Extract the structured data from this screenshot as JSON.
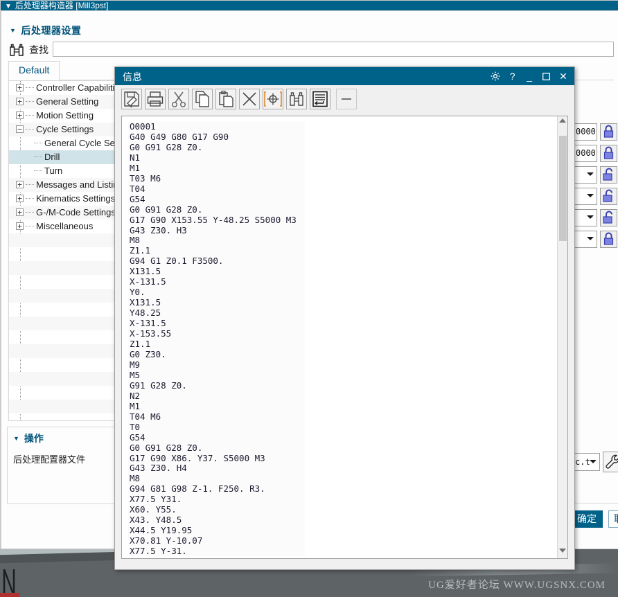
{
  "app": {
    "titlebar": "后处理器构造器  [Mill3pst]",
    "section_title": "后处理器设置",
    "find": {
      "label": "查找",
      "value": "",
      "placeholder": "",
      "icon": "binoculars-icon"
    },
    "tabs": [
      {
        "label": "Default",
        "active": true
      }
    ]
  },
  "tree": {
    "items": [
      {
        "label": "Controller Capabilities",
        "level": 0,
        "state": "collapsed",
        "selected": false
      },
      {
        "label": "General Setting",
        "level": 0,
        "state": "collapsed",
        "selected": false
      },
      {
        "label": "Motion Setting",
        "level": 0,
        "state": "collapsed",
        "selected": false
      },
      {
        "label": "Cycle Settings",
        "level": 0,
        "state": "expanded",
        "selected": false
      },
      {
        "label": "General Cycle Setting",
        "level": 1,
        "state": "leaf",
        "selected": false
      },
      {
        "label": "Drill",
        "level": 1,
        "state": "leaf",
        "selected": true
      },
      {
        "label": "Turn",
        "level": 1,
        "state": "leaf-last",
        "selected": false
      },
      {
        "label": "Messages and Listing",
        "level": 0,
        "state": "collapsed",
        "selected": false
      },
      {
        "label": "Kinematics Settings",
        "level": 0,
        "state": "collapsed",
        "selected": false
      },
      {
        "label": "G-/M-Code Settings",
        "level": 0,
        "state": "collapsed",
        "selected": false
      },
      {
        "label": "Miscellaneous",
        "level": 0,
        "state": "collapsed",
        "selected": false
      }
    ]
  },
  "operations": {
    "title": "操作",
    "items": [
      "后处理配置器文件"
    ]
  },
  "right_panel": {
    "rows": [
      {
        "type": "field",
        "value": "0000",
        "lock": "locked"
      },
      {
        "type": "field",
        "value": "0000",
        "lock": "locked"
      },
      {
        "type": "combo",
        "value": "",
        "lock": "unlocked"
      },
      {
        "type": "combo",
        "value": "",
        "lock": "unlocked"
      },
      {
        "type": "combo",
        "value": "",
        "lock": "unlocked"
      },
      {
        "type": "combo",
        "value": "",
        "lock": "locked"
      }
    ],
    "bottom_combo": "c.t",
    "wrench_icon": "wrench-icon"
  },
  "footer": {
    "ok_label": "确定",
    "second_label": "取"
  },
  "dialog": {
    "title": "信息",
    "window_buttons": [
      {
        "name": "settings-icon",
        "glyph": "⚙"
      },
      {
        "name": "help-icon",
        "glyph": "?"
      },
      {
        "name": "minimize-icon",
        "glyph": "–"
      },
      {
        "name": "maximize-icon",
        "glyph": "▭"
      },
      {
        "name": "close-icon",
        "glyph": "✕"
      }
    ],
    "toolbar": [
      {
        "name": "save-as-icon",
        "tip": "Save As"
      },
      {
        "name": "print-icon",
        "tip": "Print"
      },
      {
        "name": "cut-icon",
        "tip": "Cut"
      },
      {
        "name": "copy-icon",
        "tip": "Copy"
      },
      {
        "name": "paste-icon",
        "tip": "Paste"
      },
      {
        "name": "delete-icon",
        "tip": "Delete"
      },
      {
        "name": "locate-icon",
        "tip": "Locate"
      },
      {
        "name": "find-icon",
        "tip": "Find"
      },
      {
        "name": "word-wrap-icon",
        "tip": "Word Wrap"
      },
      {
        "name": "minus-icon",
        "tip": "Minus"
      }
    ],
    "scrollbar": {
      "thumb_top_pct": 2,
      "thumb_height_pct": 25
    },
    "text_lines": [
      "O0001",
      "G40 G49 G80 G17 G90",
      "G0 G91 G28 Z0.",
      "N1",
      "M1",
      "T03 M6",
      "T04",
      "G54",
      "G0 G91 G28 Z0.",
      "G17 G90 X153.55 Y-48.25 S5000 M3",
      "G43 Z30. H3",
      "M8",
      "Z1.1",
      "G94 G1 Z0.1 F3500.",
      "X131.5",
      "X-131.5",
      "Y0.",
      "X131.5",
      "Y48.25",
      "X-131.5",
      "X-153.55",
      "Z1.1",
      "G0 Z30.",
      "M9",
      "M5",
      "G91 G28 Z0.",
      "N2",
      "M1",
      "T04 M6",
      "T0",
      "G54",
      "G0 G91 G28 Z0.",
      "G17 G90 X86. Y37. S5000 M3",
      "G43 Z30. H4",
      "M8",
      "G94 G81 G98 Z-1. F250. R3.",
      "X77.5 Y31.",
      "X60. Y55.",
      "X43. Y48.5",
      "X44.5 Y19.95",
      "X70.81 Y-10.07",
      "X77.5 Y-31."
    ]
  },
  "watermark": "UG爱好者论坛  WWW.UGSNX.COM",
  "colors": {
    "accent": "#006189",
    "title_text": "#00527a",
    "selection": "#cfe3e9",
    "viewport_bg": "#5e6366"
  }
}
